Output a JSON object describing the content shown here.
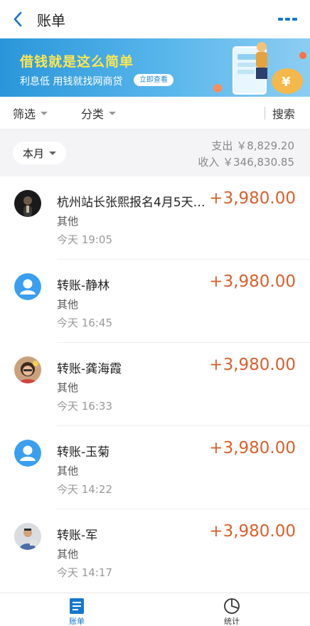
{
  "header": {
    "title": "账单"
  },
  "banner": {
    "title": "借钱就是这么简单",
    "subtitle": "利息低 用钱就找网商贷",
    "cta": "立即查看"
  },
  "filters": {
    "filter_label": "筛选",
    "category_label": "分类",
    "search_label": "搜索"
  },
  "summary": {
    "month": "本月",
    "expense": "支出 ￥8,829.20",
    "income": "收入 ￥346,830.85"
  },
  "transactions": [
    {
      "name": "杭州站长张熙报名4月5天…",
      "amount": "+3,980.00",
      "category": "其他",
      "time": "今天  19:05",
      "avatar": "photo-dark"
    },
    {
      "name": "转账-静林",
      "amount": "+3,980.00",
      "category": "其他",
      "time": "今天  16:45",
      "avatar": "default-user"
    },
    {
      "name": "转账-龚海霞",
      "amount": "+3,980.00",
      "category": "其他",
      "time": "今天  16:33",
      "avatar": "photo-woman"
    },
    {
      "name": "转账-玉菊",
      "amount": "+3,980.00",
      "category": "其他",
      "time": "今天  14:22",
      "avatar": "default-user"
    },
    {
      "name": "转账-军",
      "amount": "+3,980.00",
      "category": "其他",
      "time": "今天  14:17",
      "avatar": "photo-man"
    }
  ],
  "tabs": [
    {
      "label": "账单",
      "icon": "bill-icon",
      "active": true
    },
    {
      "label": "统计",
      "icon": "pie-chart-icon",
      "active": false
    }
  ],
  "colors": {
    "accent": "#1677d2",
    "amount": "#d9602d",
    "banner_title": "#ffe74f"
  }
}
